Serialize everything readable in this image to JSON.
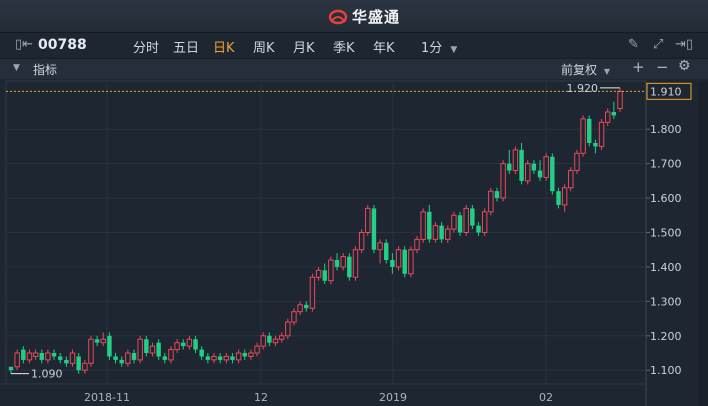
{
  "app": {
    "brand": "华盛通"
  },
  "toolbar": {
    "stock_code": "00788",
    "periods": [
      "分时",
      "五日",
      "日K",
      "周K",
      "月K",
      "季K",
      "年K"
    ],
    "active_period": "日K",
    "minute_select": "1分"
  },
  "subbar": {
    "indicator_label": "指标",
    "adjust_label": "前复权"
  },
  "colors": {
    "up": "#e84a5a",
    "down": "#21cf86",
    "accent": "#f0a52e",
    "bg": "#1e2632"
  },
  "icons": [
    "chart-toggle-icon",
    "pencil-icon",
    "fullscreen-icon",
    "exit-icon",
    "collapse-icon",
    "plus-icon",
    "minus-icon",
    "gear-icon",
    "chevron-down-icon"
  ],
  "chart_data": {
    "type": "candlestick",
    "ylim": [
      1.06,
      1.94
    ],
    "y_ticks": [
      "1.100",
      "1.200",
      "1.300",
      "1.400",
      "1.500",
      "1.600",
      "1.700",
      "1.800"
    ],
    "current_price": "1.910",
    "high_marker": "1.920",
    "low_marker": "1.090",
    "x_labels": [
      "2018-11",
      "12",
      "2019",
      "02"
    ],
    "candles": [
      [
        1.11,
        1.1,
        1.1,
        1.09
      ],
      [
        1.11,
        1.15,
        1.16,
        1.1
      ],
      [
        1.16,
        1.13,
        1.17,
        1.12
      ],
      [
        1.13,
        1.15,
        1.16,
        1.12
      ],
      [
        1.14,
        1.15,
        1.16,
        1.13
      ],
      [
        1.15,
        1.13,
        1.16,
        1.12
      ],
      [
        1.13,
        1.15,
        1.16,
        1.12
      ],
      [
        1.15,
        1.14,
        1.16,
        1.13
      ],
      [
        1.14,
        1.13,
        1.15,
        1.12
      ],
      [
        1.13,
        1.12,
        1.14,
        1.11
      ],
      [
        1.12,
        1.15,
        1.16,
        1.11
      ],
      [
        1.14,
        1.1,
        1.15,
        1.09
      ],
      [
        1.1,
        1.12,
        1.13,
        1.09
      ],
      [
        1.12,
        1.19,
        1.2,
        1.11
      ],
      [
        1.19,
        1.18,
        1.2,
        1.17
      ],
      [
        1.18,
        1.19,
        1.21,
        1.17
      ],
      [
        1.2,
        1.14,
        1.21,
        1.13
      ],
      [
        1.14,
        1.13,
        1.15,
        1.12
      ],
      [
        1.13,
        1.12,
        1.14,
        1.11
      ],
      [
        1.12,
        1.15,
        1.16,
        1.11
      ],
      [
        1.15,
        1.13,
        1.16,
        1.12
      ],
      [
        1.13,
        1.19,
        1.2,
        1.12
      ],
      [
        1.19,
        1.15,
        1.2,
        1.14
      ],
      [
        1.15,
        1.17,
        1.18,
        1.14
      ],
      [
        1.18,
        1.14,
        1.19,
        1.13
      ],
      [
        1.14,
        1.13,
        1.15,
        1.12
      ],
      [
        1.13,
        1.16,
        1.17,
        1.12
      ],
      [
        1.16,
        1.18,
        1.19,
        1.15
      ],
      [
        1.18,
        1.17,
        1.19,
        1.16
      ],
      [
        1.17,
        1.19,
        1.2,
        1.16
      ],
      [
        1.19,
        1.16,
        1.2,
        1.15
      ],
      [
        1.16,
        1.14,
        1.17,
        1.13
      ],
      [
        1.14,
        1.13,
        1.15,
        1.12
      ],
      [
        1.13,
        1.14,
        1.15,
        1.12
      ],
      [
        1.14,
        1.13,
        1.15,
        1.12
      ],
      [
        1.13,
        1.14,
        1.15,
        1.12
      ],
      [
        1.14,
        1.13,
        1.15,
        1.12
      ],
      [
        1.13,
        1.15,
        1.16,
        1.12
      ],
      [
        1.15,
        1.14,
        1.16,
        1.13
      ],
      [
        1.14,
        1.15,
        1.16,
        1.13
      ],
      [
        1.15,
        1.17,
        1.18,
        1.14
      ],
      [
        1.17,
        1.2,
        1.21,
        1.16
      ],
      [
        1.2,
        1.18,
        1.21,
        1.17
      ],
      [
        1.18,
        1.19,
        1.2,
        1.17
      ],
      [
        1.19,
        1.2,
        1.21,
        1.18
      ],
      [
        1.2,
        1.24,
        1.25,
        1.19
      ],
      [
        1.24,
        1.27,
        1.28,
        1.23
      ],
      [
        1.27,
        1.29,
        1.3,
        1.26
      ],
      [
        1.29,
        1.28,
        1.3,
        1.27
      ],
      [
        1.28,
        1.37,
        1.38,
        1.27
      ],
      [
        1.37,
        1.39,
        1.4,
        1.36
      ],
      [
        1.39,
        1.36,
        1.41,
        1.35
      ],
      [
        1.36,
        1.42,
        1.43,
        1.35
      ],
      [
        1.42,
        1.4,
        1.44,
        1.39
      ],
      [
        1.4,
        1.43,
        1.44,
        1.39
      ],
      [
        1.43,
        1.37,
        1.44,
        1.36
      ],
      [
        1.37,
        1.45,
        1.46,
        1.36
      ],
      [
        1.45,
        1.5,
        1.51,
        1.44
      ],
      [
        1.5,
        1.57,
        1.58,
        1.49
      ],
      [
        1.57,
        1.45,
        1.58,
        1.44
      ],
      [
        1.45,
        1.47,
        1.48,
        1.41
      ],
      [
        1.47,
        1.42,
        1.48,
        1.41
      ],
      [
        1.42,
        1.4,
        1.44,
        1.38
      ],
      [
        1.4,
        1.45,
        1.46,
        1.39
      ],
      [
        1.45,
        1.38,
        1.46,
        1.37
      ],
      [
        1.38,
        1.45,
        1.46,
        1.37
      ],
      [
        1.45,
        1.48,
        1.49,
        1.44
      ],
      [
        1.48,
        1.56,
        1.57,
        1.47
      ],
      [
        1.56,
        1.48,
        1.58,
        1.47
      ],
      [
        1.48,
        1.52,
        1.53,
        1.47
      ],
      [
        1.52,
        1.48,
        1.53,
        1.47
      ],
      [
        1.48,
        1.51,
        1.52,
        1.47
      ],
      [
        1.51,
        1.55,
        1.56,
        1.5
      ],
      [
        1.55,
        1.5,
        1.56,
        1.49
      ],
      [
        1.5,
        1.57,
        1.58,
        1.49
      ],
      [
        1.57,
        1.52,
        1.58,
        1.51
      ],
      [
        1.52,
        1.5,
        1.53,
        1.49
      ],
      [
        1.5,
        1.56,
        1.57,
        1.49
      ],
      [
        1.56,
        1.62,
        1.63,
        1.55
      ],
      [
        1.62,
        1.6,
        1.63,
        1.59
      ],
      [
        1.6,
        1.7,
        1.71,
        1.59
      ],
      [
        1.7,
        1.68,
        1.74,
        1.67
      ],
      [
        1.68,
        1.74,
        1.75,
        1.67
      ],
      [
        1.74,
        1.65,
        1.76,
        1.64
      ],
      [
        1.65,
        1.7,
        1.71,
        1.64
      ],
      [
        1.7,
        1.68,
        1.71,
        1.67
      ],
      [
        1.68,
        1.66,
        1.71,
        1.65
      ],
      [
        1.66,
        1.72,
        1.73,
        1.65
      ],
      [
        1.72,
        1.62,
        1.73,
        1.61
      ],
      [
        1.62,
        1.58,
        1.63,
        1.57
      ],
      [
        1.58,
        1.63,
        1.64,
        1.56
      ],
      [
        1.63,
        1.68,
        1.69,
        1.62
      ],
      [
        1.68,
        1.73,
        1.74,
        1.67
      ],
      [
        1.73,
        1.83,
        1.84,
        1.72
      ],
      [
        1.83,
        1.76,
        1.84,
        1.75
      ],
      [
        1.76,
        1.75,
        1.77,
        1.73
      ],
      [
        1.75,
        1.82,
        1.83,
        1.74
      ],
      [
        1.82,
        1.85,
        1.86,
        1.81
      ],
      [
        1.85,
        1.84,
        1.88,
        1.83
      ],
      [
        1.86,
        1.91,
        1.92,
        1.85
      ]
    ]
  }
}
